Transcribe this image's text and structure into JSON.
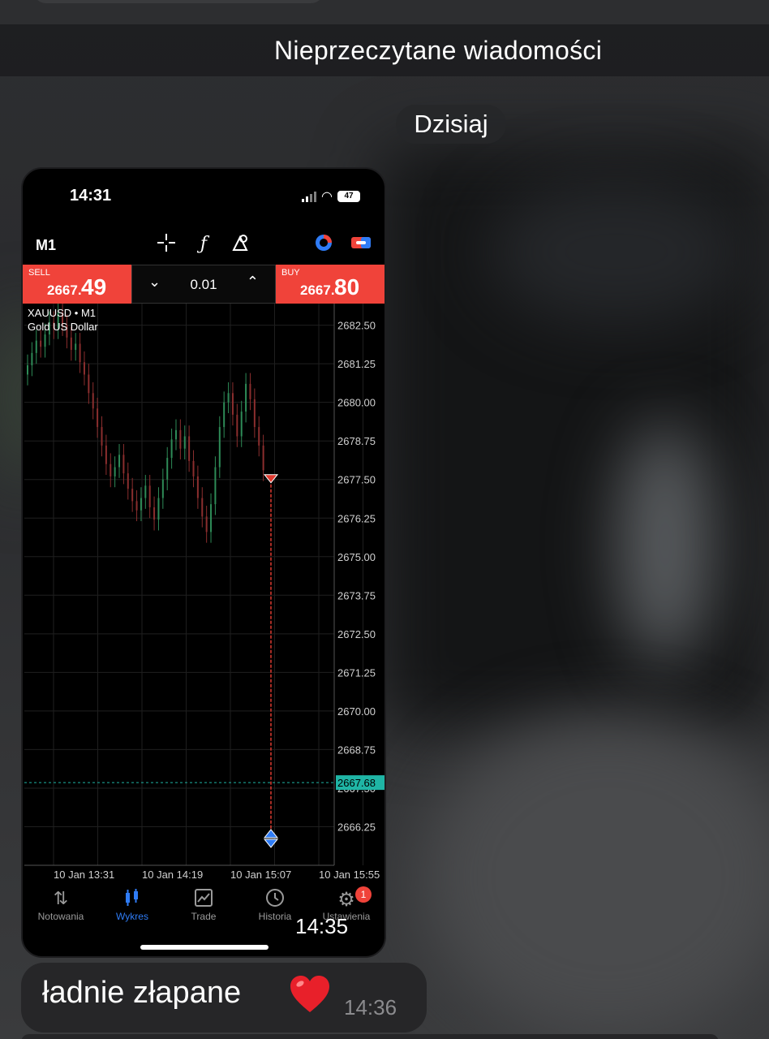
{
  "chat": {
    "unread_divider": "Nieprzeczytane wiadomości",
    "date_divider": "Dzisiaj",
    "image_message": {
      "time": "14:35"
    },
    "text_message": {
      "text": "ładnie złapane",
      "emoji": "heart",
      "time": "14:36"
    }
  },
  "screenshot": {
    "status_bar": {
      "time": "14:31",
      "battery": "47"
    },
    "timeframe": "M1",
    "toolbar_icons": [
      "crosshair-icon",
      "function-icon",
      "objects-icon",
      "trade-clock-icon",
      "toggle-icon"
    ],
    "sell": {
      "label": "SELL",
      "price_small": "2667.",
      "price_big": "49"
    },
    "buy": {
      "label": "BUY",
      "price_small": "2667.",
      "price_big": "80"
    },
    "volume": "0.01",
    "symbol_line": "XAUUSD • M1",
    "symbol_desc": "Gold US Dollar",
    "current_price_label": "2667.68",
    "tabs": [
      {
        "label": "Notowania",
        "icon": "quotes-arrows-icon",
        "active": false
      },
      {
        "label": "Wykres",
        "icon": "candlestick-icon",
        "active": true
      },
      {
        "label": "Trade",
        "icon": "trade-chart-icon",
        "active": false
      },
      {
        "label": "Historia",
        "icon": "history-clock-icon",
        "active": false
      },
      {
        "label": "Ustawienia",
        "icon": "settings-gear-icon",
        "active": false,
        "badge": "1"
      }
    ]
  },
  "chart_data": {
    "type": "candlestick",
    "title": "XAUUSD • M1",
    "subtitle": "Gold US Dollar",
    "ylim": [
      2665.0,
      2683.2
    ],
    "y_ticks": [
      2682.5,
      2681.25,
      2680.0,
      2678.75,
      2677.5,
      2676.25,
      2675.0,
      2673.75,
      2672.5,
      2671.25,
      2670.0,
      2668.75,
      2667.5,
      2666.25
    ],
    "x_tick_labels": [
      "10 Jan 13:31",
      "10 Jan 14:19",
      "10 Jan 15:07",
      "10 Jan 15:55"
    ],
    "close_series": [
      2681.2,
      2681.6,
      2682.0,
      2681.8,
      2682.2,
      2682.6,
      2682.4,
      2682.9,
      2682.5,
      2682.1,
      2681.7,
      2681.9,
      2681.3,
      2680.9,
      2680.3,
      2679.8,
      2679.2,
      2678.6,
      2678.0,
      2677.6,
      2677.9,
      2678.3,
      2677.7,
      2677.2,
      2676.8,
      2676.5,
      2676.9,
      2677.3,
      2676.6,
      2676.2,
      2676.9,
      2677.5,
      2678.2,
      2678.8,
      2679.1,
      2678.5,
      2678.9,
      2678.1,
      2677.6,
      2676.9,
      2676.3,
      2675.8,
      2676.7,
      2677.9,
      2679.2,
      2680.0,
      2680.3,
      2679.6,
      2678.9,
      2679.7,
      2680.6,
      2680.1,
      2679.2,
      2678.6,
      2677.8
    ],
    "sell_marker_price": 2677.5,
    "buy_marker_price": 2666.0,
    "current_price": 2667.68,
    "grid": true
  }
}
